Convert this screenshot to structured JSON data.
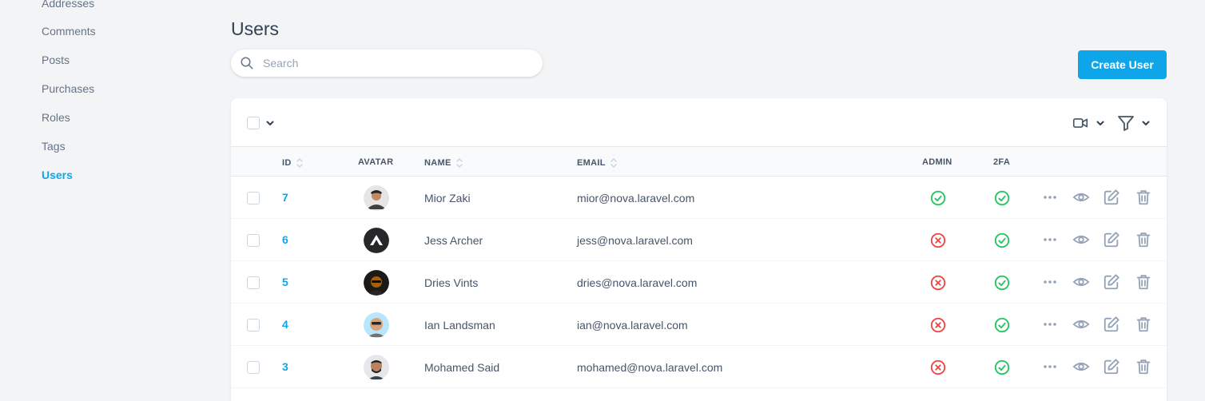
{
  "sidebar": {
    "items": [
      {
        "label": "Addresses",
        "active": false
      },
      {
        "label": "Comments",
        "active": false
      },
      {
        "label": "Posts",
        "active": false
      },
      {
        "label": "Purchases",
        "active": false
      },
      {
        "label": "Roles",
        "active": false
      },
      {
        "label": "Tags",
        "active": false
      },
      {
        "label": "Users",
        "active": true
      }
    ]
  },
  "page": {
    "title": "Users"
  },
  "search": {
    "placeholder": "Search",
    "value": ""
  },
  "create_button": {
    "label": "Create User"
  },
  "colors": {
    "accent": "#0ea5e9",
    "success": "#22c55e",
    "danger": "#ef4444",
    "icon_gray": "#94a3b8"
  },
  "table": {
    "columns": [
      {
        "key": "id",
        "label": "ID",
        "sortable": true
      },
      {
        "key": "avatar",
        "label": "AVATAR",
        "sortable": false
      },
      {
        "key": "name",
        "label": "NAME",
        "sortable": true
      },
      {
        "key": "email",
        "label": "EMAIL",
        "sortable": true
      },
      {
        "key": "admin",
        "label": "ADMIN",
        "sortable": false
      },
      {
        "key": "twofa",
        "label": "2FA",
        "sortable": false
      }
    ],
    "toolbar_icons": [
      "select-all-checkbox",
      "chevron-down-icon",
      "video-camera-icon",
      "filter-icon"
    ],
    "rows": [
      {
        "id": "7",
        "name": "Mior Zaki",
        "email": "mior@nova.laravel.com",
        "admin": true,
        "twofa": true
      },
      {
        "id": "6",
        "name": "Jess Archer",
        "email": "jess@nova.laravel.com",
        "admin": false,
        "twofa": true
      },
      {
        "id": "5",
        "name": "Dries Vints",
        "email": "dries@nova.laravel.com",
        "admin": false,
        "twofa": true
      },
      {
        "id": "4",
        "name": "Ian Landsman",
        "email": "ian@nova.laravel.com",
        "admin": false,
        "twofa": true
      },
      {
        "id": "3",
        "name": "Mohamed Said",
        "email": "mohamed@nova.laravel.com",
        "admin": false,
        "twofa": true
      }
    ],
    "row_actions": [
      "more-icon",
      "view-icon",
      "edit-icon",
      "delete-icon"
    ]
  }
}
